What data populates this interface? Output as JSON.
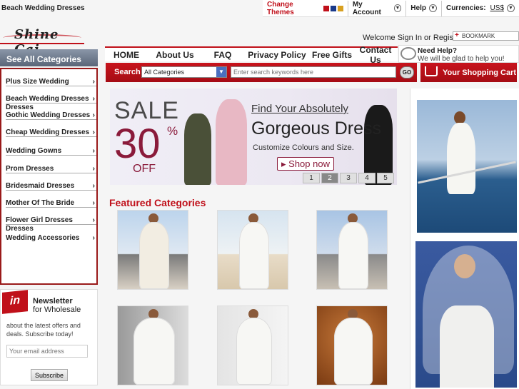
{
  "page_heading": "Beach Wedding Dresses",
  "topbar": {
    "themes_label": "Change Themes",
    "theme_colors": [
      "#c0101a",
      "#1a3a8a",
      "#d8a020"
    ],
    "account_label": "My Account",
    "help_label": "Help",
    "currencies_label": "Currencies:",
    "currency_value": "US$"
  },
  "logo_text": "Shine Cai",
  "welcome": {
    "text": "Welcome",
    "sign_in": "Sign In",
    "or": "or",
    "register": "Register"
  },
  "bookmark_label": "BOOKMARK",
  "nav": {
    "items": [
      "HOME",
      "About Us",
      "FAQ",
      "Privacy Policy",
      "Free Gifts",
      "Contact Us"
    ]
  },
  "need_help": {
    "title": "Need Help?",
    "subtitle": "We will be glad to help you!"
  },
  "search": {
    "label": "Search",
    "category_value": "All Categories",
    "placeholder": "Enter search keywords here",
    "go_label": "GO"
  },
  "cart_label": "Your Shopping Cart",
  "sidebar": {
    "header": "See All Categories",
    "items": [
      "Plus Size Wedding Dresses",
      "Beach Wedding Dresses",
      "Gothic Wedding Dresses",
      "Cheap Wedding Dresses",
      "Wedding Gowns",
      "Prom Dresses",
      "Bridesmaid Dresses",
      "Mother Of The Bride Dresses",
      "Flower Girl Dresses",
      "Wedding Accessories"
    ]
  },
  "newsletter": {
    "icon_text": "in",
    "title": "Newsletter",
    "subtitle": "for Wholesale",
    "description": "about the latest offers and deals. Subscribe today!",
    "email_placeholder": "Your email address",
    "button_label": "Subscribe"
  },
  "banner": {
    "sale": "SALE",
    "percent": "30",
    "percent_sign": "%",
    "off": "OFF",
    "find": "Find Your Absolutely",
    "gorgeous": "Gorgeous Dress",
    "customize": "Customize Colours and Size.",
    "shop_now": "Shop now",
    "pages": [
      "1",
      "2",
      "3",
      "4",
      "5"
    ],
    "active_page": "2"
  },
  "featured": {
    "title": "Featured Categories"
  },
  "colors": {
    "accent": "#c0101a",
    "nav_bg": "#ffffff",
    "sidebar_header": "#6a7588"
  }
}
